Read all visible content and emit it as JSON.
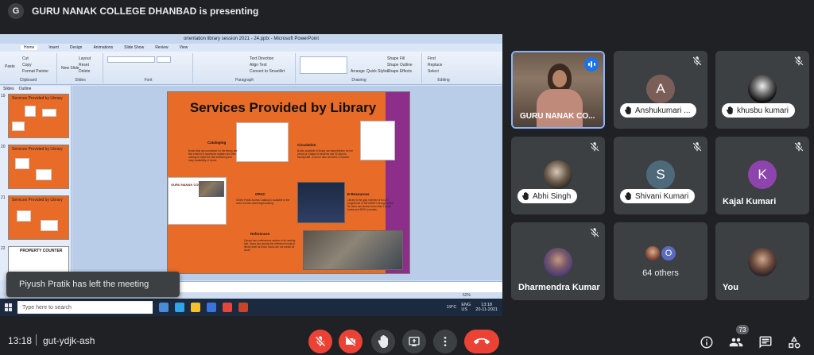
{
  "presenting": {
    "avatar_letter": "G",
    "text": "GURU NANAK COLLEGE DHANBAD is presenting"
  },
  "shared_screen": {
    "window_title": "orientation library session 2021 - 24.pptx - Microsoft PowerPoint",
    "tabs": [
      "Home",
      "Insert",
      "Design",
      "Animations",
      "Slide Show",
      "Review",
      "View"
    ],
    "ribbon_groups": [
      "Clipboard",
      "Slides",
      "Font",
      "Paragraph",
      "Drawing",
      "Editing"
    ],
    "ribbon_items": {
      "paste": "Paste",
      "cut": "Cut",
      "copy": "Copy",
      "format_painter": "Format Painter",
      "new_slide": "New Slide",
      "layout": "Layout",
      "reset": "Reset",
      "delete": "Delete",
      "text_direction": "Text Direction",
      "align_text": "Align Text",
      "convert_smartart": "Convert to SmartArt",
      "arrange": "Arrange",
      "quick_styles": "Quick Styles",
      "shape_fill": "Shape Fill",
      "shape_outline": "Shape Outline",
      "shape_effects": "Shape Effects",
      "find": "Find",
      "replace": "Replace",
      "select": "Select"
    },
    "pane_tabs": [
      "Slides",
      "Outline"
    ],
    "thumbnails": [
      {
        "num": "19",
        "title": "Services Provided by Library"
      },
      {
        "num": "20",
        "title": "Services Provided by Library"
      },
      {
        "num": "21",
        "title": "Services Provided by Library"
      },
      {
        "num": "22",
        "title": "PROPERTY COUNTER"
      }
    ],
    "slide": {
      "title": "Services Provided by Library",
      "cataloging_head": "Cataloging",
      "cataloging_text": "Books that are purchased for the library are first entered in accession register and then catalog to make the fast searching and easy availability of books.",
      "circulation_head": "Circulation",
      "circulation_text": "Books available in library are issued/return for the period of 14days to students and 30 days to faculty/staff. It can be also renewed, if needed.",
      "opac_head": "OPAC",
      "opac_text": "Online Public Access Catalog is available to the users for fast searching/browsing.",
      "eresources_head": "E-Resources",
      "eresources_text": "Library is the gold member of N-LIST programme of INFLIBNET through which its users can access more than 1.5lakh books and 6000+ journals.",
      "references_head": "References",
      "references_text": "Library has a references section in its reading hall. Users can access the reference books in library itself as those books are not meant for issue.",
      "logo_text": "GURU NANAK COLLEGE"
    },
    "status": {
      "zoom": "62%"
    },
    "taskbar": {
      "search_placeholder": "Type here to search",
      "temp": "19°C",
      "lang": "ENG",
      "region": "US",
      "time": "13:18",
      "date": "20-11-2021"
    }
  },
  "toast": "Piyush Pratik has left the meeting",
  "participants": [
    {
      "name": "GURU NANAK CO...",
      "type": "video",
      "speaking": true
    },
    {
      "name": "Anshukumari ...",
      "type": "letter",
      "letter": "A",
      "color": "#7b5e57",
      "pill": true
    },
    {
      "name": "khusbu kumari",
      "type": "photo",
      "pill": true
    },
    {
      "name": "Abhi Singh",
      "type": "photo",
      "pill": true
    },
    {
      "name": "Shivani Kumari",
      "type": "letter",
      "letter": "S",
      "color": "#4e6a7a",
      "pill": true
    },
    {
      "name": "Kajal Kumari",
      "type": "letter",
      "letter": "K",
      "color": "#8e44ad",
      "pill": false
    },
    {
      "name": "Dharmendra Kumar",
      "type": "photo",
      "pill": false
    },
    {
      "name": "64 others",
      "type": "others",
      "letter": "O"
    },
    {
      "name": "You",
      "type": "photo",
      "pill": false
    }
  ],
  "bottom_bar": {
    "time": "13:18",
    "meeting_code": "gut-ydjk-ash",
    "people_count": "73"
  },
  "colors": {
    "meet_bg": "#202124",
    "tile_bg": "#3c4043",
    "danger": "#ea4335",
    "slide_orange": "#e86b28",
    "slide_purple": "#8d2f8a",
    "speaking_blue": "#1a73e8"
  },
  "icons": [
    "mic-off-icon",
    "camera-off-icon",
    "raise-hand-icon",
    "present-icon",
    "more-options-icon",
    "end-call-icon",
    "info-icon",
    "people-icon",
    "chat-icon",
    "activities-icon"
  ]
}
